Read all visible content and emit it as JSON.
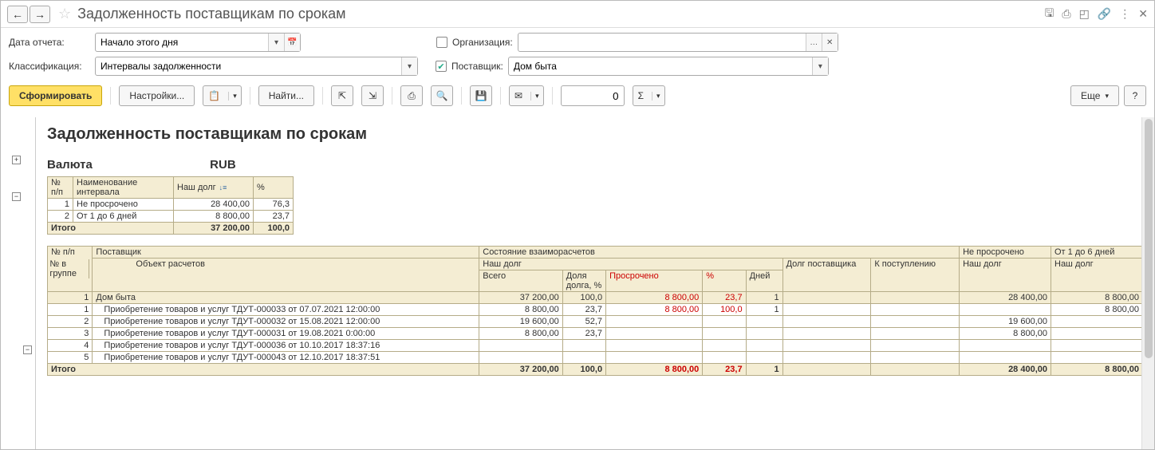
{
  "title": "Задолженность поставщикам по срокам",
  "filters": {
    "date_label": "Дата отчета:",
    "date_value": "Начало этого дня",
    "org_label": "Организация:",
    "org_value": "",
    "class_label": "Классификация:",
    "class_value": "Интервалы задолженности",
    "supplier_label": "Поставщик:",
    "supplier_value": "Дом быта"
  },
  "toolbar": {
    "generate": "Сформировать",
    "settings": "Настройки...",
    "find": "Найти...",
    "num_value": "0",
    "more": "Еще",
    "help": "?"
  },
  "report": {
    "heading": "Задолженность поставщикам по срокам",
    "currency_label": "Валюта",
    "currency_value": "RUB",
    "summary_headers": {
      "n": "№ п/п",
      "name": "Наименование интервала",
      "debt": "Наш долг",
      "pct": "%"
    },
    "summary_rows": [
      {
        "n": "1",
        "name": "Не просрочено",
        "debt": "28 400,00",
        "pct": "76,3"
      },
      {
        "n": "2",
        "name": "От 1 до 6 дней",
        "debt": "8 800,00",
        "pct": "23,7"
      }
    ],
    "summary_total": {
      "label": "Итого",
      "debt": "37 200,00",
      "pct": "100,0"
    },
    "detail_headers": {
      "n_pp": "№ п/п",
      "supplier": "Поставщик",
      "state": "Состояние взаиморасчетов",
      "not_overdue": "Не просрочено",
      "range1": "От 1 до 6 дней",
      "n_grp": "№ в группе",
      "object": "Объект расчетов",
      "our_debt": "Наш долг",
      "supplier_debt": "Долг поставщика",
      "incoming": "К поступлению",
      "total": "Всего",
      "share": "Доля долга, %",
      "overdue": "Просрочено",
      "pct": "%",
      "days": "Дней"
    },
    "group_row": {
      "n": "1",
      "supplier": "Дом быта",
      "total": "37 200,00",
      "share": "100,0",
      "overdue": "8 800,00",
      "pct": "23,7",
      "days": "1",
      "not_overdue": "28 400,00",
      "range1": "8 800,00"
    },
    "detail_rows": [
      {
        "n": "1",
        "obj": "Приобретение товаров и услуг ТДУТ-000033 от 07.07.2021 12:00:00",
        "total": "8 800,00",
        "share": "23,7",
        "overdue": "8 800,00",
        "pct": "100,0",
        "days": "1",
        "not_overdue": "",
        "range1": "8 800,00"
      },
      {
        "n": "2",
        "obj": "Приобретение товаров и услуг ТДУТ-000032 от 15.08.2021 12:00:00",
        "total": "19 600,00",
        "share": "52,7",
        "overdue": "",
        "pct": "",
        "days": "",
        "not_overdue": "19 600,00",
        "range1": ""
      },
      {
        "n": "3",
        "obj": "Приобретение товаров и услуг ТДУТ-000031 от 19.08.2021 0:00:00",
        "total": "8 800,00",
        "share": "23,7",
        "overdue": "",
        "pct": "",
        "days": "",
        "not_overdue": "8 800,00",
        "range1": ""
      },
      {
        "n": "4",
        "obj": "Приобретение товаров и услуг ТДУТ-000036 от 10.10.2017 18:37:16",
        "total": "",
        "share": "",
        "overdue": "",
        "pct": "",
        "days": "",
        "not_overdue": "",
        "range1": ""
      },
      {
        "n": "5",
        "obj": "Приобретение товаров и услуг ТДУТ-000043 от 12.10.2017 18:37:51",
        "total": "",
        "share": "",
        "overdue": "",
        "pct": "",
        "days": "",
        "not_overdue": "",
        "range1": ""
      }
    ],
    "detail_total": {
      "label": "Итого",
      "total": "37 200,00",
      "share": "100,0",
      "overdue": "8 800,00",
      "pct": "23,7",
      "days": "1",
      "not_overdue": "28 400,00",
      "range1": "8 800,00"
    }
  }
}
